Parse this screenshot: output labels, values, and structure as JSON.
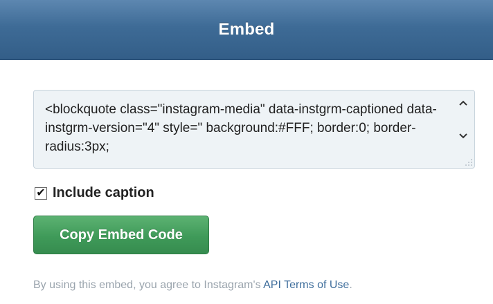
{
  "header": {
    "title": "Embed"
  },
  "embed": {
    "code": "<blockquote class=\"instagram-media\" data-instgrm-captioned data-instgrm-version=\"4\" style=\" background:#FFF; border:0; border-radius:3px;"
  },
  "caption_option": {
    "label": "Include caption",
    "checked": true,
    "check_mark": "✔"
  },
  "copy_button": {
    "label": "Copy Embed Code"
  },
  "terms": {
    "prefix": "By using this embed, you agree to Instagram's ",
    "link_label": "API Terms of Use",
    "suffix": "."
  },
  "colors": {
    "header": "#3e6b96",
    "button": "#3f9a59",
    "link": "#3f6e9c"
  }
}
